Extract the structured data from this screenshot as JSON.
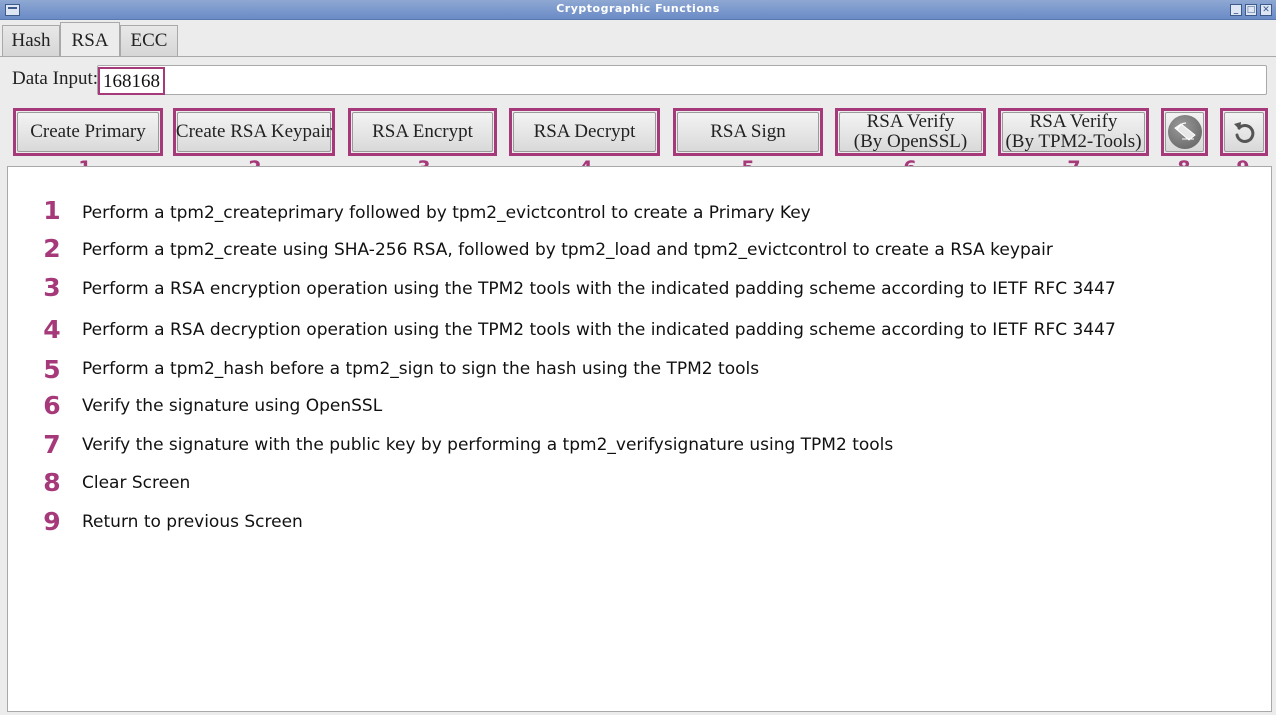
{
  "window": {
    "title": "Cryptographic Functions"
  },
  "tabs": [
    {
      "label": "Hash"
    },
    {
      "label": "RSA"
    },
    {
      "label": "ECC"
    }
  ],
  "active_tab": "RSA",
  "data_input": {
    "label": "Data Input:",
    "value": "168168"
  },
  "buttons": {
    "create_primary": {
      "label": "Create Primary",
      "num": "1"
    },
    "create_rsa_keypair": {
      "label": "Create RSA Keypair",
      "num": "2"
    },
    "rsa_encrypt": {
      "label": "RSA Encrypt",
      "num": "3"
    },
    "rsa_decrypt": {
      "label": "RSA Decrypt",
      "num": "4"
    },
    "rsa_sign": {
      "label": "RSA Sign",
      "num": "5"
    },
    "rsa_verify_openssl": {
      "line1": "RSA Verify",
      "line2": "(By OpenSSL)",
      "num": "6"
    },
    "rsa_verify_tpm2": {
      "line1": "RSA Verify",
      "line2": "(By TPM2-Tools)",
      "num": "7"
    },
    "clear_screen": {
      "icon": "eraser-icon",
      "num": "8"
    },
    "back": {
      "icon": "back-arrow-icon",
      "num": "9"
    }
  },
  "instructions": [
    {
      "num": "1",
      "text": "Perform a tpm2_createprimary followed by tpm2_evictcontrol to create a Primary Key"
    },
    {
      "num": "2",
      "text": "Perform a tpm2_create using SHA-256 RSA, followed by tpm2_load and tpm2_evictcontrol to create a RSA keypair"
    },
    {
      "num": "3",
      "text": "Perform a RSA encryption operation using  the TPM2 tools with the indicated padding scheme according to IETF RFC 3447"
    },
    {
      "num": "4",
      "text": "Perform a RSA decryption operation using  the TPM2 tools with the indicated padding scheme according to IETF RFC 3447"
    },
    {
      "num": "5",
      "text": "Perform a tpm2_hash before a tpm2_sign to sign the hash using the TPM2 tools"
    },
    {
      "num": "6",
      "text": "Verify the signature using OpenSSL"
    },
    {
      "num": "7",
      "text": "Verify the signature with the public key by performing a tpm2_verifysignature using TPM2 tools"
    },
    {
      "num": "8",
      "text": "Clear Screen"
    },
    {
      "num": "9",
      "text": "Return to previous Screen"
    }
  ],
  "colors": {
    "annotation": "#a6397a",
    "titlebar": "#7b97cc"
  }
}
